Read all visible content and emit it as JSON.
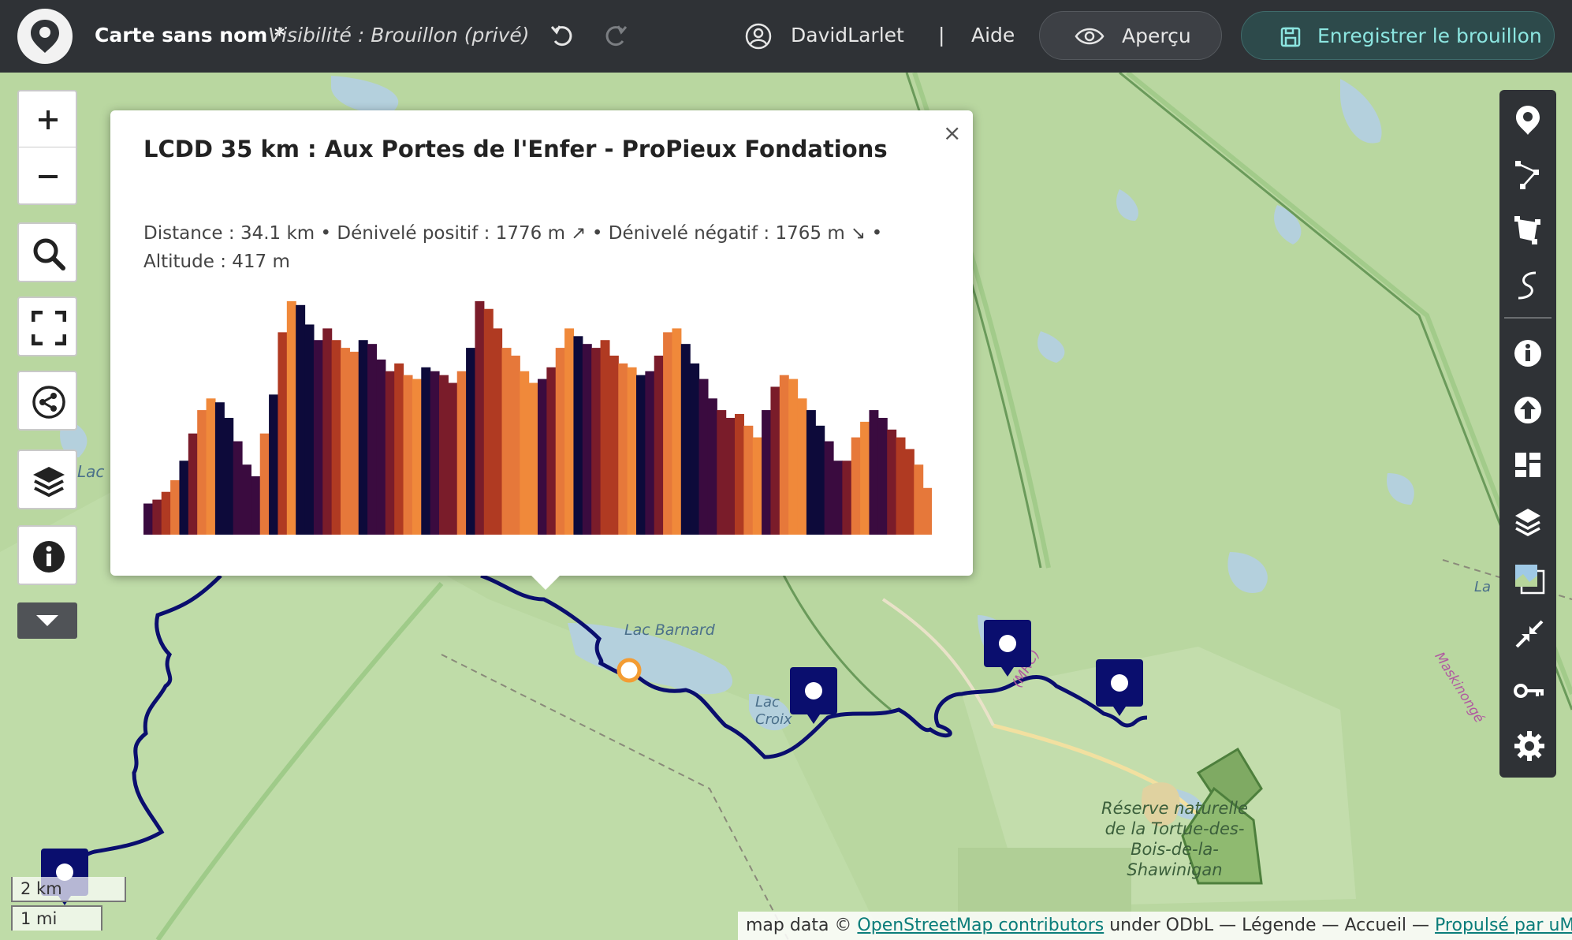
{
  "header": {
    "map_name": "Carte sans nom *",
    "visibility": "Visibilité : Brouillon (privé)",
    "username": "DavidLarlet",
    "separator": "|",
    "help_label": "Aide",
    "preview_label": "Aperçu",
    "save_label": "Enregistrer le brouillon"
  },
  "popup": {
    "title": "LCDD 35 km : Aux Portes de l'Enfer - ProPieux Fondations",
    "stats": "Distance : 34.1 km • Dénivelé positif : 1776 m ↗ • Dénivelé négatif : 1765 m ↘ • Altitude : 417 m",
    "close": "×",
    "elevation_profile": [
      40,
      45,
      55,
      70,
      95,
      130,
      160,
      175,
      170,
      150,
      120,
      90,
      75,
      130,
      180,
      260,
      300,
      295,
      270,
      250,
      265,
      250,
      240,
      235,
      250,
      245,
      225,
      210,
      220,
      205,
      200,
      215,
      210,
      205,
      195,
      210,
      240,
      300,
      290,
      265,
      240,
      230,
      210,
      195,
      200,
      215,
      240,
      265,
      255,
      245,
      240,
      250,
      230,
      220,
      215,
      205,
      210,
      230,
      260,
      265,
      245,
      220,
      200,
      175,
      160,
      150,
      155,
      140,
      125,
      160,
      190,
      205,
      200,
      175,
      160,
      140,
      120,
      95,
      95,
      125,
      145,
      160,
      150,
      135,
      125,
      110,
      90,
      60
    ],
    "profile_colors": [
      "#0d0a3a",
      "#3a0b3f",
      "#7a1c2a",
      "#b03a22",
      "#e6783a",
      "#f0893a"
    ]
  },
  "map": {
    "labels": {
      "lac_barnard": "Lac Barnard",
      "lac_croix": "Lac Croix",
      "lac_left": "Lac",
      "reserve": "Réserve naturelle de la Tortue-des-Bois-de-la-Shawinigan",
      "maskinonge": "Maskinongé",
      "mrc": "(MRC)",
      "lac_right": "La"
    },
    "route_color": "#0a0e6e",
    "marker_color": "#0a0e6e",
    "waypoint_color": "#f39c33"
  },
  "scale": {
    "km": "2 km",
    "mi": "1 mi"
  },
  "attribution": {
    "prefix": "map data © ",
    "osm": "OpenStreetMap contributors",
    "license": " under ODbL — ",
    "legend": "Légende",
    "dash1": " — ",
    "home": "Accueil",
    "dash2": " — ",
    "powered": "Propulsé par uMap"
  },
  "icons": {
    "left": [
      "plus-icon",
      "minus-icon",
      "search-icon",
      "fullscreen-icon",
      "share-icon",
      "layers-icon",
      "info-icon",
      "chevron-down-icon"
    ],
    "right": [
      "marker-icon",
      "polyline-icon",
      "polygon-icon",
      "route-icon",
      "info-icon",
      "upload-icon",
      "dashboard-icon",
      "layers-icon",
      "tilelayer-icon",
      "center-icon",
      "key-icon",
      "settings-icon"
    ]
  }
}
